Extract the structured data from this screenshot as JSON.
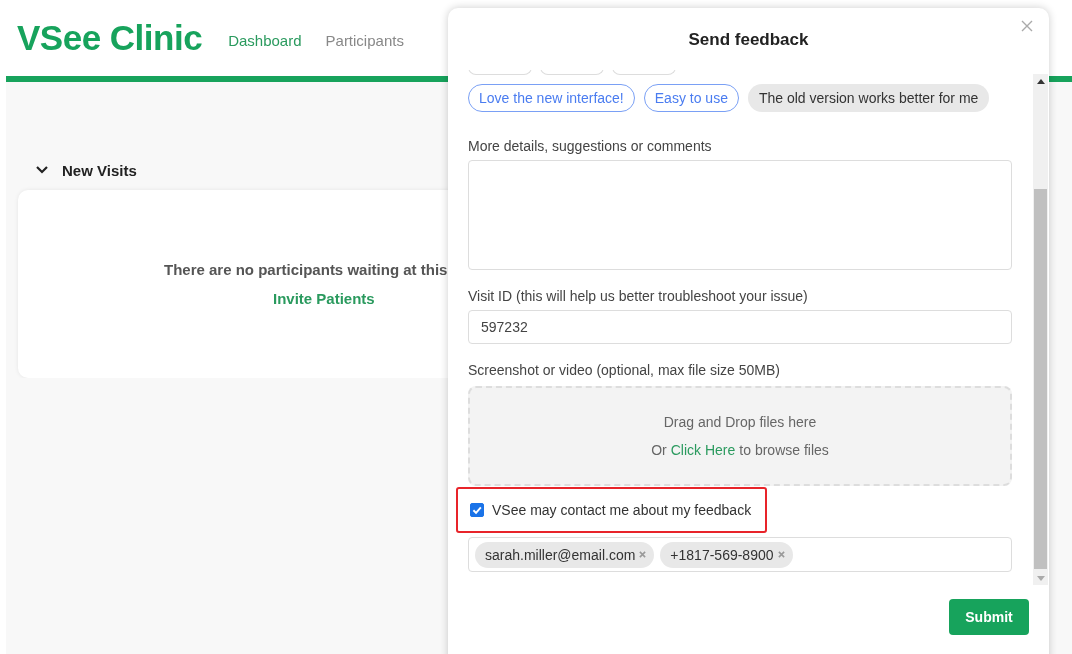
{
  "header": {
    "logo": "VSee Clinic",
    "nav": [
      {
        "label": "Dashboard",
        "selected": true
      },
      {
        "label": "Participants",
        "selected": false
      }
    ]
  },
  "section": {
    "title": "New Visits",
    "expanded": true,
    "empty_message": "There are no participants waiting at this",
    "action": "Invite Patients"
  },
  "dialog": {
    "title": "Send feedback",
    "tags": [
      {
        "label": "Love the new interface!",
        "selected": true
      },
      {
        "label": "Easy to use",
        "selected": true
      },
      {
        "label": "The old version works better for me",
        "selected": false
      }
    ],
    "comments": {
      "label": "More details, suggestions or comments"
    },
    "visit_id": {
      "label": "Visit ID (this will help us better troubleshoot your issue)",
      "value": "597232"
    },
    "upload": {
      "label": "Screenshot or video (optional, max file size 50MB)",
      "drop_text": "Drag and Drop files here",
      "browse_prefix": "Or",
      "browse_link": "Click Here",
      "browse_suffix": "to browse files"
    },
    "contact": {
      "label": "VSee may contact me about my feedback",
      "checked": true,
      "highlighted": true
    },
    "contacts": [
      {
        "label": "sarah.miller@email.com"
      },
      {
        "label": "+1817-569-8900"
      }
    ],
    "submit": "Submit"
  }
}
